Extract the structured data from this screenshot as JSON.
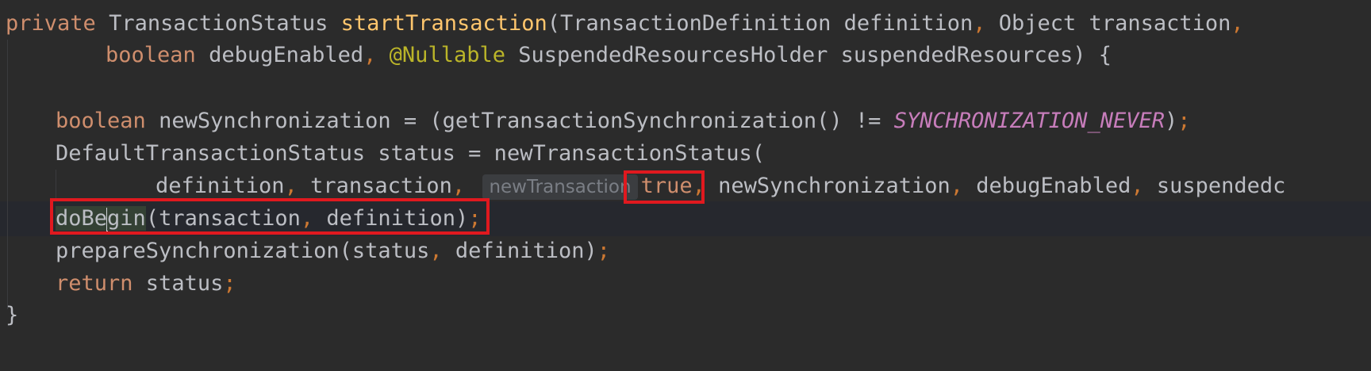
{
  "code": {
    "line1": {
      "private": "private",
      "type": "TransactionStatus",
      "method": "startTransaction",
      "paren_open": "(",
      "p1_type": "TransactionDefinition",
      "p1_name": "definition",
      "comma1": ",",
      "p2": "Object transaction",
      "comma2": ","
    },
    "line2": {
      "boolean": "boolean",
      "p3": "debugEnabled",
      "comma": ",",
      "annotation": "@Nullable",
      "p4": "SuspendedResourcesHolder suspendedResources",
      "end": ") {"
    },
    "line4": {
      "boolean": "boolean",
      "expr1": "newSynchronization = (getTransactionSynchronization() != ",
      "const": "SYNCHRONIZATION_NEVER",
      "close": ")",
      "semi": ";"
    },
    "line5": {
      "text": "DefaultTransactionStatus status = newTransactionStatus("
    },
    "line6": {
      "arg1": "definition",
      "comma1": ",",
      "arg2": "transaction",
      "comma2": ",",
      "hint": "newTransaction",
      "arg3": "true",
      "comma3": ",",
      "arg4": "newSynchronization",
      "comma4": ",",
      "arg5": "debugEnabled",
      "comma5": ",",
      "arg6": "suspendedc"
    },
    "line7": {
      "method_a": "doBe",
      "method_b": "gin",
      "open": "(transaction",
      "comma": ",",
      "close": " definition)",
      "semi": ";"
    },
    "line8": {
      "text": "prepareSynchronization(status",
      "comma": ",",
      "rest": " definition)",
      "semi": ";"
    },
    "line9": {
      "return": "return",
      "rest": " status",
      "semi": ";"
    },
    "line10": {
      "brace": "}"
    }
  },
  "colors": {
    "background": "#2b2b2b",
    "keyword": "#cf8e6d",
    "method_decl": "#ffc66d",
    "annotation": "#bbb529",
    "constant": "#c77dbb",
    "text": "#bcbec4",
    "highlight_box": "#e0191f"
  }
}
